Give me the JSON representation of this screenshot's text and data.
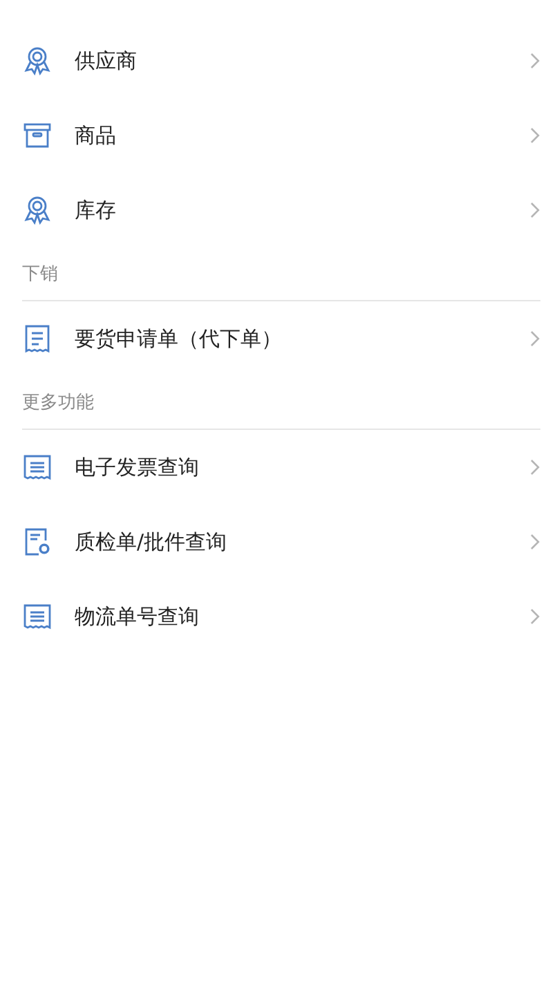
{
  "sections": [
    {
      "items": [
        {
          "label": "供应商",
          "kind": "award"
        },
        {
          "label": "商品",
          "kind": "box"
        },
        {
          "label": "库存",
          "kind": "award"
        }
      ]
    },
    {
      "title": "下销",
      "items": [
        {
          "label": "要货申请单（代下单）",
          "kind": "receipt"
        }
      ]
    },
    {
      "title": "更多功能",
      "items": [
        {
          "label": "电子发票查询",
          "kind": "list"
        },
        {
          "label": "质检单/批件查询",
          "kind": "doccheck"
        },
        {
          "label": "物流单号查询",
          "kind": "list"
        }
      ]
    }
  ]
}
